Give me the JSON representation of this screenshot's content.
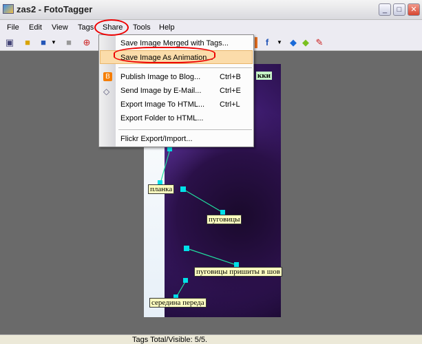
{
  "window": {
    "title": "zas2 - FotoTagger",
    "controls": [
      "minimize",
      "maximize",
      "close"
    ]
  },
  "menubar": [
    "File",
    "Edit",
    "View",
    "Tags",
    "Share",
    "Tools",
    "Help"
  ],
  "toolbar": {
    "icons": [
      "open-folder-view-icon",
      "open-icon",
      "save-icon",
      "dropdown-arrow",
      "disabled-icon",
      "zoom-in-icon",
      "facebook-icon",
      "dropdown-arrow",
      "back-arrow-icon",
      "forward-arrow-icon",
      "tag-tool-icon"
    ],
    "facebook_glyph": "f"
  },
  "share_menu": {
    "items": [
      {
        "label": "Save Image Merged with Tags...",
        "shortcut": ""
      },
      {
        "label": "Save Image As Animation...",
        "shortcut": "",
        "highlighted": true
      },
      {
        "label": "Publish Image to Blog...",
        "shortcut": "Ctrl+B",
        "icon": "blogger-icon"
      },
      {
        "label": "Send Image by E-Mail...",
        "shortcut": "Ctrl+E",
        "icon": "email-tag-icon"
      },
      {
        "label": "Export Image To HTML...",
        "shortcut": "Ctrl+L"
      },
      {
        "label": "Export Folder to HTML...",
        "shortcut": ""
      },
      {
        "label": "Flickr Export/Import...",
        "shortcut": ""
      }
    ]
  },
  "tags": [
    {
      "text": "кки"
    },
    {
      "text": "планка"
    },
    {
      "text": "пуговицы"
    },
    {
      "text": "пуговицы пришиты в шов"
    },
    {
      "text": "середина переда"
    }
  ],
  "status": {
    "text": "Tags Total/Visible: 5/5."
  },
  "colors": {
    "annotation": "#e00000",
    "menu_highlight": "#fbdcaa",
    "tag_bg": "#ffffc0",
    "tag_line": "#20e0a0",
    "tag_dot": "#00e0e8"
  }
}
